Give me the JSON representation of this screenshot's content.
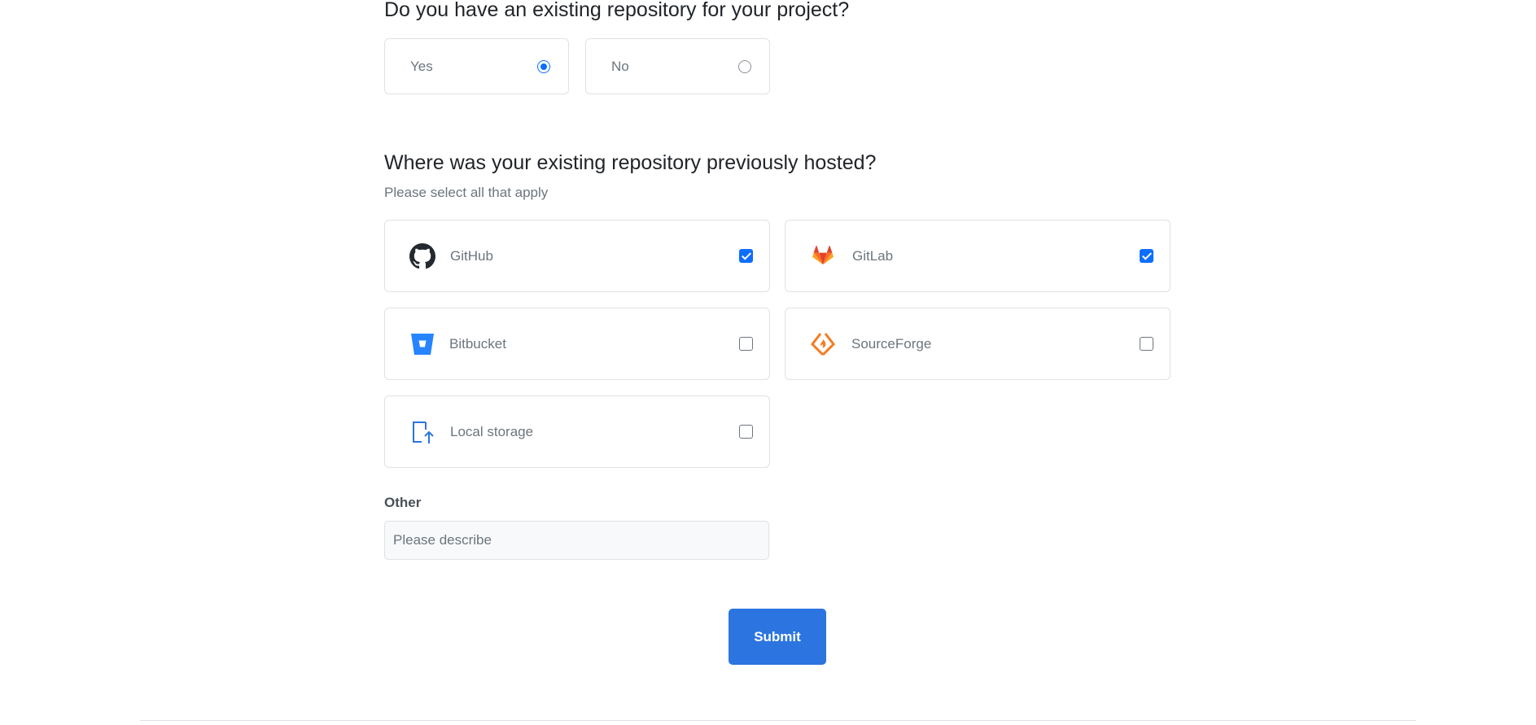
{
  "question_repo": {
    "title": "Do you have an existing repository for your project?",
    "options": [
      {
        "label": "Yes",
        "selected": true
      },
      {
        "label": "No",
        "selected": false
      }
    ]
  },
  "question_host": {
    "title": "Where was your existing repository previously hosted?",
    "subtitle": "Please select all that apply",
    "options": [
      {
        "label": "GitHub",
        "icon": "github-icon",
        "checked": true
      },
      {
        "label": "GitLab",
        "icon": "gitlab-icon",
        "checked": true
      },
      {
        "label": "Bitbucket",
        "icon": "bitbucket-icon",
        "checked": false
      },
      {
        "label": "SourceForge",
        "icon": "sourceforge-icon",
        "checked": false
      },
      {
        "label": "Local storage",
        "icon": "local-storage-icon",
        "checked": false
      }
    ]
  },
  "other": {
    "label": "Other",
    "placeholder": "Please describe",
    "value": ""
  },
  "submit": {
    "label": "Submit"
  },
  "colors": {
    "accent": "#0d6efd",
    "button": "#2c75e0",
    "gitlab_orange": "#e24329",
    "sourceforge_orange": "#f47c20",
    "bitbucket_blue": "#2684ff"
  }
}
